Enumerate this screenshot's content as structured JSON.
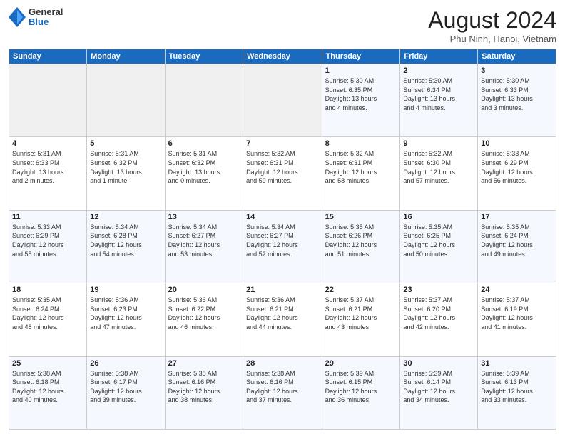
{
  "header": {
    "logo_general": "General",
    "logo_blue": "Blue",
    "month_title": "August 2024",
    "location": "Phu Ninh, Hanoi, Vietnam"
  },
  "weekdays": [
    "Sunday",
    "Monday",
    "Tuesday",
    "Wednesday",
    "Thursday",
    "Friday",
    "Saturday"
  ],
  "weeks": [
    [
      {
        "day": "",
        "info": ""
      },
      {
        "day": "",
        "info": ""
      },
      {
        "day": "",
        "info": ""
      },
      {
        "day": "",
        "info": ""
      },
      {
        "day": "1",
        "info": "Sunrise: 5:30 AM\nSunset: 6:35 PM\nDaylight: 13 hours\nand 4 minutes."
      },
      {
        "day": "2",
        "info": "Sunrise: 5:30 AM\nSunset: 6:34 PM\nDaylight: 13 hours\nand 4 minutes."
      },
      {
        "day": "3",
        "info": "Sunrise: 5:30 AM\nSunset: 6:33 PM\nDaylight: 13 hours\nand 3 minutes."
      }
    ],
    [
      {
        "day": "4",
        "info": "Sunrise: 5:31 AM\nSunset: 6:33 PM\nDaylight: 13 hours\nand 2 minutes."
      },
      {
        "day": "5",
        "info": "Sunrise: 5:31 AM\nSunset: 6:32 PM\nDaylight: 13 hours\nand 1 minute."
      },
      {
        "day": "6",
        "info": "Sunrise: 5:31 AM\nSunset: 6:32 PM\nDaylight: 13 hours\nand 0 minutes."
      },
      {
        "day": "7",
        "info": "Sunrise: 5:32 AM\nSunset: 6:31 PM\nDaylight: 12 hours\nand 59 minutes."
      },
      {
        "day": "8",
        "info": "Sunrise: 5:32 AM\nSunset: 6:31 PM\nDaylight: 12 hours\nand 58 minutes."
      },
      {
        "day": "9",
        "info": "Sunrise: 5:32 AM\nSunset: 6:30 PM\nDaylight: 12 hours\nand 57 minutes."
      },
      {
        "day": "10",
        "info": "Sunrise: 5:33 AM\nSunset: 6:29 PM\nDaylight: 12 hours\nand 56 minutes."
      }
    ],
    [
      {
        "day": "11",
        "info": "Sunrise: 5:33 AM\nSunset: 6:29 PM\nDaylight: 12 hours\nand 55 minutes."
      },
      {
        "day": "12",
        "info": "Sunrise: 5:34 AM\nSunset: 6:28 PM\nDaylight: 12 hours\nand 54 minutes."
      },
      {
        "day": "13",
        "info": "Sunrise: 5:34 AM\nSunset: 6:27 PM\nDaylight: 12 hours\nand 53 minutes."
      },
      {
        "day": "14",
        "info": "Sunrise: 5:34 AM\nSunset: 6:27 PM\nDaylight: 12 hours\nand 52 minutes."
      },
      {
        "day": "15",
        "info": "Sunrise: 5:35 AM\nSunset: 6:26 PM\nDaylight: 12 hours\nand 51 minutes."
      },
      {
        "day": "16",
        "info": "Sunrise: 5:35 AM\nSunset: 6:25 PM\nDaylight: 12 hours\nand 50 minutes."
      },
      {
        "day": "17",
        "info": "Sunrise: 5:35 AM\nSunset: 6:24 PM\nDaylight: 12 hours\nand 49 minutes."
      }
    ],
    [
      {
        "day": "18",
        "info": "Sunrise: 5:35 AM\nSunset: 6:24 PM\nDaylight: 12 hours\nand 48 minutes."
      },
      {
        "day": "19",
        "info": "Sunrise: 5:36 AM\nSunset: 6:23 PM\nDaylight: 12 hours\nand 47 minutes."
      },
      {
        "day": "20",
        "info": "Sunrise: 5:36 AM\nSunset: 6:22 PM\nDaylight: 12 hours\nand 46 minutes."
      },
      {
        "day": "21",
        "info": "Sunrise: 5:36 AM\nSunset: 6:21 PM\nDaylight: 12 hours\nand 44 minutes."
      },
      {
        "day": "22",
        "info": "Sunrise: 5:37 AM\nSunset: 6:21 PM\nDaylight: 12 hours\nand 43 minutes."
      },
      {
        "day": "23",
        "info": "Sunrise: 5:37 AM\nSunset: 6:20 PM\nDaylight: 12 hours\nand 42 minutes."
      },
      {
        "day": "24",
        "info": "Sunrise: 5:37 AM\nSunset: 6:19 PM\nDaylight: 12 hours\nand 41 minutes."
      }
    ],
    [
      {
        "day": "25",
        "info": "Sunrise: 5:38 AM\nSunset: 6:18 PM\nDaylight: 12 hours\nand 40 minutes."
      },
      {
        "day": "26",
        "info": "Sunrise: 5:38 AM\nSunset: 6:17 PM\nDaylight: 12 hours\nand 39 minutes."
      },
      {
        "day": "27",
        "info": "Sunrise: 5:38 AM\nSunset: 6:16 PM\nDaylight: 12 hours\nand 38 minutes."
      },
      {
        "day": "28",
        "info": "Sunrise: 5:38 AM\nSunset: 6:16 PM\nDaylight: 12 hours\nand 37 minutes."
      },
      {
        "day": "29",
        "info": "Sunrise: 5:39 AM\nSunset: 6:15 PM\nDaylight: 12 hours\nand 36 minutes."
      },
      {
        "day": "30",
        "info": "Sunrise: 5:39 AM\nSunset: 6:14 PM\nDaylight: 12 hours\nand 34 minutes."
      },
      {
        "day": "31",
        "info": "Sunrise: 5:39 AM\nSunset: 6:13 PM\nDaylight: 12 hours\nand 33 minutes."
      }
    ]
  ]
}
